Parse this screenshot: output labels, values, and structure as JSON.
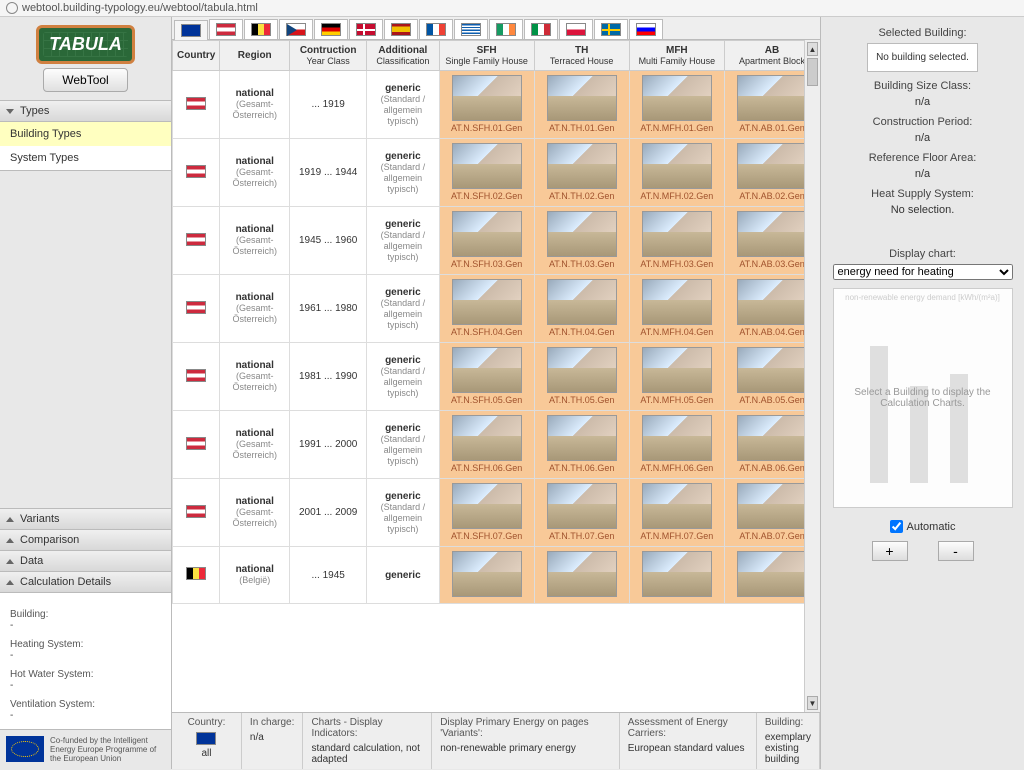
{
  "url": "webtool.building-typology.eu/webtool/tabula.html",
  "logo": "TABULA",
  "webtool_btn": "WebTool",
  "accordion": {
    "types": {
      "header": "Types",
      "items": [
        "Building Types",
        "System Types"
      ],
      "active": 0
    },
    "variants": "Variants",
    "comparison": "Comparison",
    "data": "Data",
    "calc": "Calculation Details"
  },
  "calc_details": {
    "building": {
      "lbl": "Building:",
      "val": "-"
    },
    "heating": {
      "lbl": "Heating System:",
      "val": "-"
    },
    "hotwater": {
      "lbl": "Hot Water System:",
      "val": "-"
    },
    "ventilation": {
      "lbl": "Ventilation System:",
      "val": "-"
    }
  },
  "iee_text": "Co-funded by the Intelligent Energy Europe Programme of the European Union",
  "columns": [
    {
      "t": "Country"
    },
    {
      "t": "Region"
    },
    {
      "t": "Contruction",
      "s": "Year Class"
    },
    {
      "t": "Additional",
      "s": "Classification"
    },
    {
      "t": "SFH",
      "s": "Single Family House"
    },
    {
      "t": "TH",
      "s": "Terraced House"
    },
    {
      "t": "MFH",
      "s": "Multi Family House"
    },
    {
      "t": "AB",
      "s": "Apartment Block"
    }
  ],
  "region": {
    "name": "national",
    "sub": "(Gesamt-Österreich)"
  },
  "classi": {
    "name": "generic",
    "sub": "(Standard / allgemein typisch)"
  },
  "rows": [
    {
      "flag": "f-at",
      "year": "... 1919",
      "codes": [
        "AT.N.SFH.01.Gen",
        "AT.N.TH.01.Gen",
        "AT.N.MFH.01.Gen",
        "AT.N.AB.01.Gen"
      ]
    },
    {
      "flag": "f-at",
      "year": "1919 ... 1944",
      "codes": [
        "AT.N.SFH.02.Gen",
        "AT.N.TH.02.Gen",
        "AT.N.MFH.02.Gen",
        "AT.N.AB.02.Gen"
      ]
    },
    {
      "flag": "f-at",
      "year": "1945 ... 1960",
      "codes": [
        "AT.N.SFH.03.Gen",
        "AT.N.TH.03.Gen",
        "AT.N.MFH.03.Gen",
        "AT.N.AB.03.Gen"
      ]
    },
    {
      "flag": "f-at",
      "year": "1961 ... 1980",
      "codes": [
        "AT.N.SFH.04.Gen",
        "AT.N.TH.04.Gen",
        "AT.N.MFH.04.Gen",
        "AT.N.AB.04.Gen"
      ]
    },
    {
      "flag": "f-at",
      "year": "1981 ... 1990",
      "codes": [
        "AT.N.SFH.05.Gen",
        "AT.N.TH.05.Gen",
        "AT.N.MFH.05.Gen",
        "AT.N.AB.05.Gen"
      ]
    },
    {
      "flag": "f-at",
      "year": "1991 ... 2000",
      "codes": [
        "AT.N.SFH.06.Gen",
        "AT.N.TH.06.Gen",
        "AT.N.MFH.06.Gen",
        "AT.N.AB.06.Gen"
      ]
    },
    {
      "flag": "f-at",
      "year": "2001 ... 2009",
      "codes": [
        "AT.N.SFH.07.Gen",
        "AT.N.TH.07.Gen",
        "AT.N.MFH.07.Gen",
        "AT.N.AB.07.Gen"
      ]
    },
    {
      "flag": "f-be",
      "year": "... 1945",
      "classi_only": "generic",
      "region": {
        "name": "national",
        "sub": "(België)"
      },
      "codes": [
        "",
        "",
        "",
        ""
      ],
      "clipped": true
    }
  ],
  "footer": {
    "c1": {
      "lbl": "Country:",
      "val": "all"
    },
    "c2": {
      "lbl": "In charge:",
      "val": "n/a"
    },
    "c3": {
      "lbl": "Charts - Display Indicators:",
      "val": "standard calculation, not adapted"
    },
    "c4": {
      "lbl": "Display Primary Energy on pages 'Variants':",
      "val": "non-renewable primary energy"
    },
    "c5": {
      "lbl": "Assessment of Energy Carriers:",
      "val": "European standard values"
    },
    "c6": {
      "lbl": "Building:",
      "val": "exemplary existing building"
    }
  },
  "right": {
    "selected_lbl": "Selected Building:",
    "selected_box": "No building selected.",
    "size_lbl": "Building Size Class:",
    "size_val": "n/a",
    "period_lbl": "Construction Period:",
    "period_val": "n/a",
    "floor_lbl": "Reference Floor Area:",
    "floor_val": "n/a",
    "heat_lbl": "Heat Supply System:",
    "heat_val": "No selection.",
    "chart_lbl": "Display chart:",
    "chart_sel": "energy need for heating",
    "chart_hint_title": "non-renewable energy demand [kWh/(m²a)]",
    "chart_msg": "Select a Building to display the Calculation Charts.",
    "auto": "Automatic",
    "plus": "+",
    "minus": "-"
  },
  "flag_tabs": [
    "f-eu",
    "f-at",
    "f-be",
    "f-cz",
    "f-de",
    "f-dk",
    "f-es",
    "f-fr",
    "f-gr",
    "f-ie",
    "f-it",
    "f-pl",
    "f-se",
    "f-si"
  ]
}
